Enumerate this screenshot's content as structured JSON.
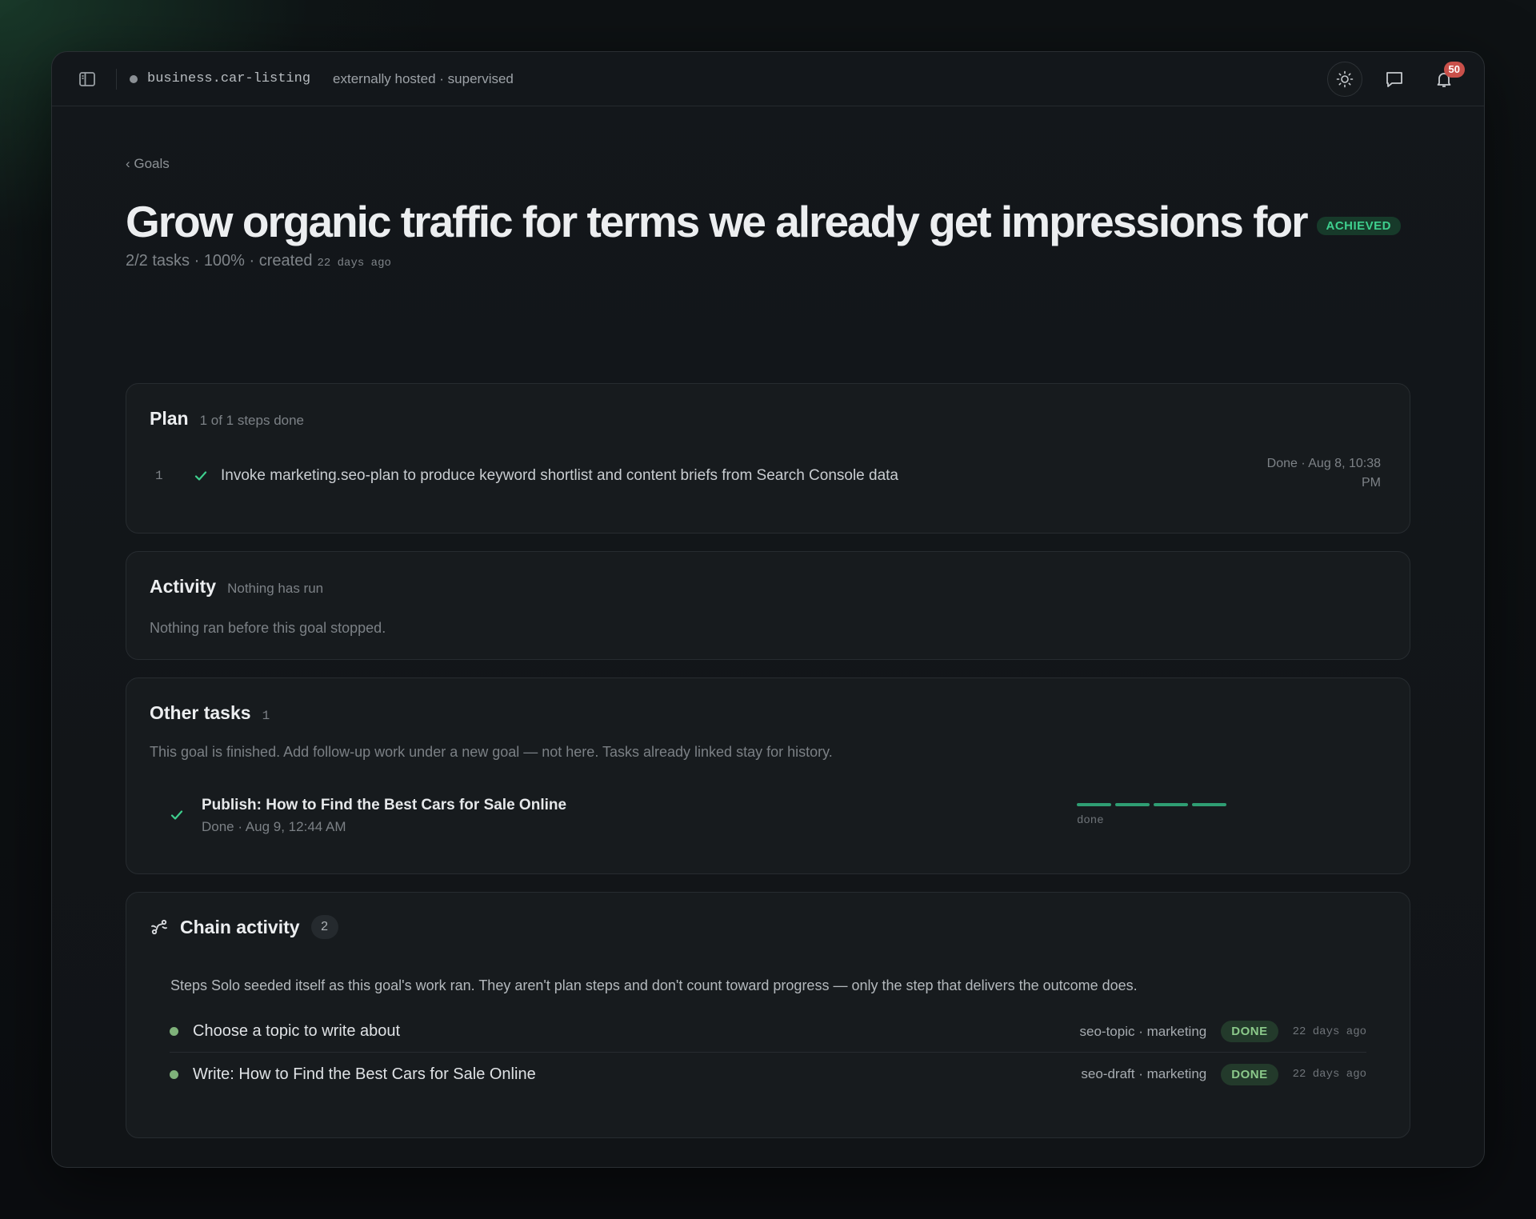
{
  "topbar": {
    "project": "business.car-listing",
    "hosting": "externally hosted · supervised",
    "notification_count": "50"
  },
  "page": {
    "back_label": "‹ Goals",
    "title": "Grow organic traffic for terms we already get impressions for",
    "status_badge": "ACHIEVED",
    "meta": "2/2 tasks · 100% · created",
    "meta_age": "22 days ago"
  },
  "plan": {
    "title": "Plan",
    "subtitle": "1 of 1 steps done",
    "steps": [
      {
        "num": "1",
        "text": "Invoke marketing.seo-plan to produce keyword shortlist and content briefs from Search Console data",
        "date_line1": "Done · Aug 8, 10:38",
        "date_line2": "PM"
      }
    ]
  },
  "activity": {
    "title": "Activity",
    "subtitle": "Nothing has run",
    "message": "Nothing ran before this goal stopped."
  },
  "other_tasks": {
    "title": "Other tasks",
    "count": "1",
    "notice": "This goal is finished. Add follow-up work under a new goal — not here. Tasks already linked stay for history.",
    "items": [
      {
        "title": "Publish: How to Find the Best Cars for Sale Online",
        "date": "Done · Aug 9, 12:44 AM",
        "progress_label": "done",
        "progress_steps_done": 4,
        "progress_steps_total": 4
      }
    ]
  },
  "chain": {
    "title": "Chain activity",
    "count": "2",
    "description": "Steps Solo seeded itself as this goal's work ran. They aren't plan steps and don't count toward progress — only the step that delivers the outcome does.",
    "rows": [
      {
        "label": "Choose a topic to write about",
        "tags": "seo-topic · marketing",
        "status": "DONE",
        "ago": "22 days ago"
      },
      {
        "label": "Write: How to Find the Best Cars for Sale Online",
        "tags": "seo-draft · marketing",
        "status": "DONE",
        "ago": "22 days ago"
      }
    ]
  },
  "colors": {
    "accent_green": "#3ecf8e",
    "done_green": "#8bc98a",
    "badge_red": "#c9504a"
  },
  "icons": [
    "sidebar-toggle-icon",
    "sun-icon",
    "chat-icon",
    "bell-icon",
    "check-icon",
    "chain-icon"
  ]
}
